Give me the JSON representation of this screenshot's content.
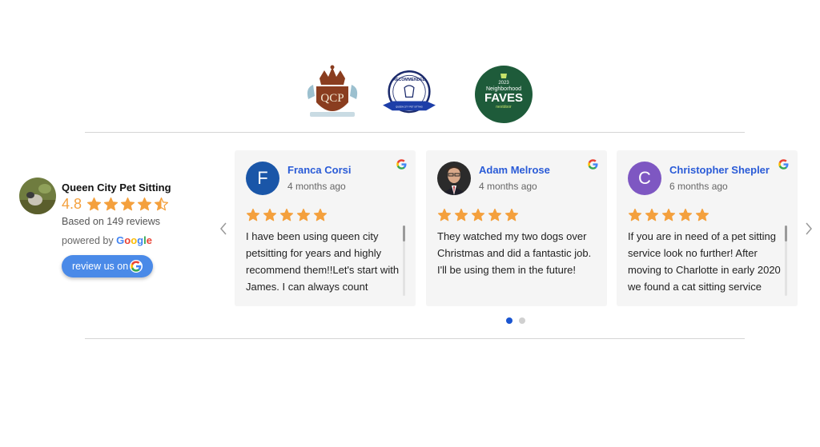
{
  "summary": {
    "business_name": "Queen City Pet Sitting",
    "rating": "4.8",
    "rating_value": 4.8,
    "stars_out_of": 5,
    "review_count": "Based on 149 reviews",
    "powered_by": "powered by",
    "google_word": "Google",
    "review_button": "review us on"
  },
  "badges": {
    "qcp_text": "QCP",
    "best_pros_text": "RECOMMENDED",
    "best_pros_small": "QUEEN CITY PET SITTING",
    "faves_year": "2023",
    "faves_line1": "Neighborhood",
    "faves_line2": "FAVES",
    "faves_brand": "nextdoor"
  },
  "reviews": [
    {
      "name": "Franca Corsi",
      "date": "4 months ago",
      "initial": "F",
      "avatar_color": "#1a56a8",
      "stars": 5,
      "text": "I have been using queen city petsitting for years and highly recommend them!!Let's start with James. I can always count"
    },
    {
      "name": "Adam Melrose",
      "date": "4 months ago",
      "initial": "",
      "avatar_color": "#3a3a3a",
      "stars": 5,
      "text": "They watched my two dogs over Christmas and did a fantastic job. I'll be using them in the future!"
    },
    {
      "name": "Christopher Shepler",
      "date": "6 months ago",
      "initial": "C",
      "avatar_color": "#7e57c2",
      "stars": 5,
      "text": "If you are in need of a pet sitting service look no further!  After moving to Charlotte in early 2020 we found a cat sitting service"
    }
  ],
  "carousel": {
    "pages": 2,
    "active_page": 1
  },
  "colors": {
    "star": "#f4a03d",
    "accent_blue": "#2a5bd7",
    "button": "#4a8ae8",
    "dot_active": "#1a55d1"
  },
  "icons": {
    "google": "google-g-icon",
    "prev": "chevron-left-icon",
    "next": "chevron-right-icon"
  }
}
